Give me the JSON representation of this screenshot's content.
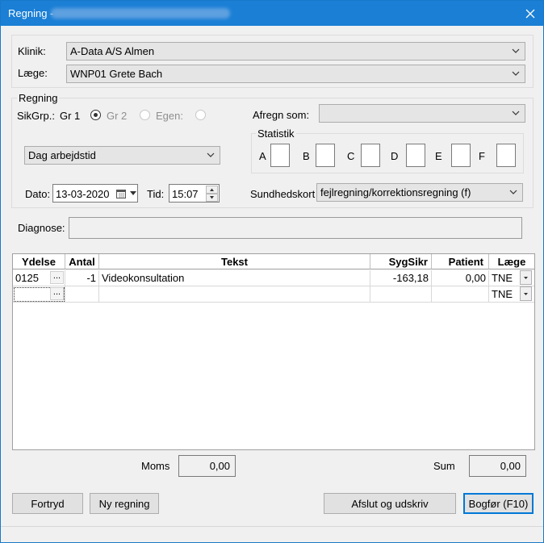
{
  "window": {
    "title": "Regning -",
    "title_blurred": "(redacted)"
  },
  "header": {
    "klinik_label": "Klinik:",
    "klinik_value": "A-Data A/S Almen",
    "laege_label": "Læge:",
    "laege_value": "WNP01 Grete Bach"
  },
  "regning": {
    "group_label": "Regning",
    "sikgrp_label": "SikGrp.:",
    "gr1_label": "Gr 1",
    "gr2_label": "Gr 2",
    "egen_label": "Egen:",
    "afregn_label": "Afregn som:",
    "afregn_value": "",
    "tid_type_value": "Dag arbejdstid",
    "dato_label": "Dato:",
    "dato_value": "13-03-2020",
    "tid_label": "Tid:",
    "tid_value": "15:07",
    "statistik_label": "Statistik",
    "statistik_fields": [
      {
        "label": "A",
        "value": ""
      },
      {
        "label": "B",
        "value": ""
      },
      {
        "label": "C",
        "value": ""
      },
      {
        "label": "D",
        "value": ""
      },
      {
        "label": "E",
        "value": ""
      },
      {
        "label": "F",
        "value": ""
      }
    ],
    "sundhedskort_label": "Sundhedskort",
    "sundhedskort_value": "fejlregning/korrektionsregning (f)"
  },
  "diagnose": {
    "label": "Diagnose:",
    "value": ""
  },
  "grid": {
    "columns": [
      "Ydelse",
      "Antal",
      "Tekst",
      "SygSikr",
      "Patient",
      "Læge"
    ],
    "rows": [
      {
        "ydelse": "0125",
        "antal": "-1",
        "tekst": "Videokonsultation",
        "sygsikr": "-163,18",
        "patient": "0,00",
        "laege": "TNE"
      },
      {
        "ydelse": "",
        "antal": "",
        "tekst": "",
        "sygsikr": "",
        "patient": "",
        "laege": "TNE"
      }
    ],
    "ellipsis": "...",
    "dropdown_glyph": "▾"
  },
  "totals": {
    "moms_label": "Moms",
    "moms_value": "0,00",
    "sum_label": "Sum",
    "sum_value": "0,00"
  },
  "buttons": {
    "fortryd": "Fortryd",
    "ny_regning": "Ny regning",
    "afslut": "Afslut og udskriv",
    "bogfor": "Bogfør (F10)"
  },
  "colors": {
    "titlebar": "#1a7fd5",
    "default_button_border": "#0078d7"
  },
  "icons": {
    "close": "close-icon",
    "chevron": "chevron-down-icon",
    "calendar": "calendar-icon"
  }
}
